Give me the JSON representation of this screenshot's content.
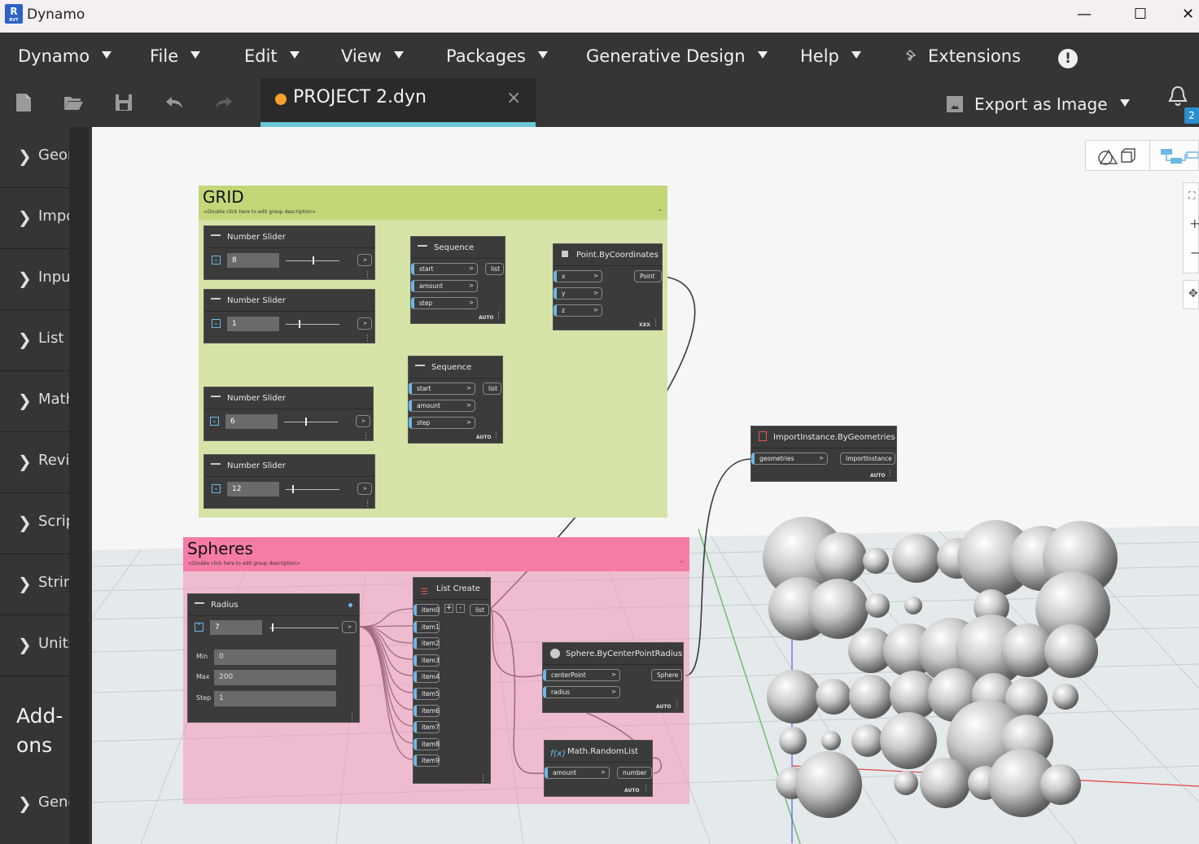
{
  "window": {
    "title": "Dynamo",
    "logo": "R",
    "logo_sub": "RVT",
    "minimize": "—",
    "maximize": "☐",
    "close": "✕"
  },
  "menu": {
    "items": [
      "Dynamo",
      "File",
      "Edit",
      "View",
      "Packages",
      "Generative Design",
      "Help"
    ],
    "extensions": "Extensions",
    "extensions_icon": "pin-icon",
    "info_icon": "!"
  },
  "toolbar": {
    "icons": [
      "new-file-icon",
      "open-folder-icon",
      "save-icon",
      "undo-icon",
      "redo-icon"
    ],
    "tab_title": "PROJECT 2.dyn",
    "tab_close": "×",
    "export": "Export as Image",
    "notification_count": "2"
  },
  "library": {
    "items": [
      "Geometry",
      "Import",
      "Input",
      "List",
      "Math",
      "Revit",
      "Script",
      "String",
      "Units"
    ],
    "addons_title": "Add-ons",
    "addon_items": [
      "Generative Design"
    ]
  },
  "graph": {
    "groups": [
      {
        "title": "GRID",
        "desc": "<Double click here to edit group description>",
        "color": "#d6e3a7",
        "header_color": "#c3d778"
      },
      {
        "title": "Spheres",
        "desc": "<Double click here to edit group description>",
        "color": "#f6b3c8",
        "header_color": "#f67ca6"
      }
    ],
    "sliders": [
      {
        "title": "Number Slider",
        "value": "8"
      },
      {
        "title": "Number Slider",
        "value": "1"
      },
      {
        "title": "Number Slider",
        "value": "6"
      },
      {
        "title": "Number Slider",
        "value": "12"
      }
    ],
    "sequence": {
      "title": "Sequence",
      "inputs": [
        "start",
        "amount",
        "step"
      ],
      "output": "list",
      "lacing": "AUTO"
    },
    "point": {
      "title": "Point.ByCoordinates",
      "inputs": [
        "x",
        "y",
        "z"
      ],
      "output": "Point",
      "lacing": "XXX"
    },
    "import": {
      "title": "ImportInstance.ByGeometries",
      "input": "geometries",
      "output": "ImportInstance",
      "lacing": "AUTO"
    },
    "radius": {
      "title": "Radius",
      "value": "7",
      "min_label": "Min",
      "min": "0",
      "max_label": "Max",
      "max": "200",
      "step_label": "Step",
      "step": "1"
    },
    "list_create": {
      "title": "List Create",
      "items": [
        "item0",
        "item1",
        "item2",
        "item3",
        "item4",
        "item5",
        "item6",
        "item7",
        "item8",
        "item9"
      ],
      "output": "list",
      "plus": "+",
      "minus": "-"
    },
    "sphere": {
      "title": "Sphere.ByCenterPointRadius",
      "inputs": [
        "centerPoint",
        "radius"
      ],
      "output": "Sphere",
      "lacing": "AUTO"
    },
    "random": {
      "title": "Math.RandomList",
      "input": "amount",
      "output": "number",
      "lacing": "AUTO"
    }
  },
  "colors": {
    "accent": "#6ac6d4",
    "unsaved_dot": "#f6a12b",
    "port_blue": "#6cb8e4",
    "badge": "#2b8fce"
  }
}
